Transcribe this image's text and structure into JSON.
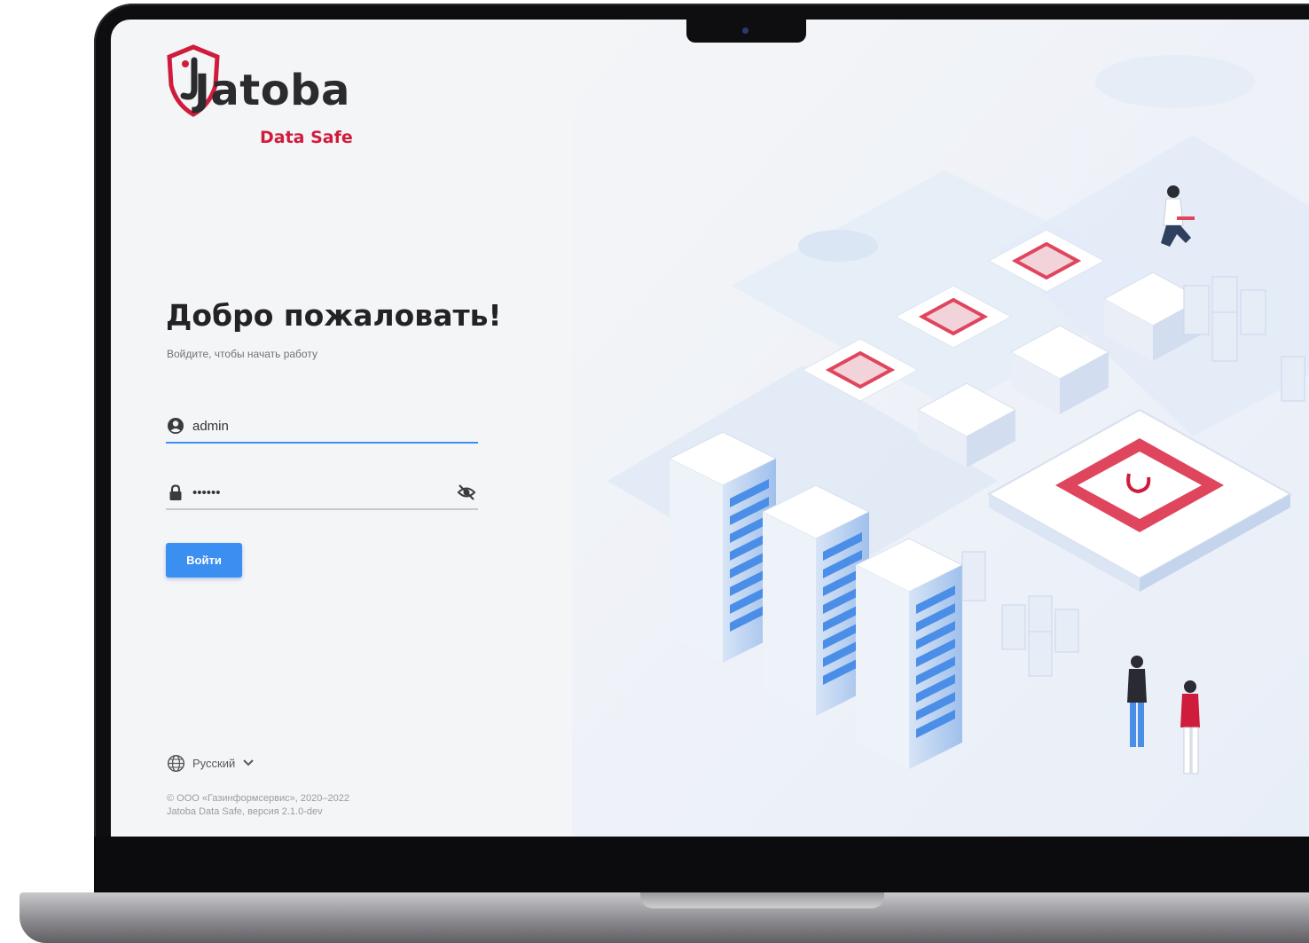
{
  "brand": {
    "name": "Jatoba",
    "tagline": "Data Safe",
    "accent_color": "#d01c3c"
  },
  "login": {
    "title": "Добро пожаловать!",
    "subtitle": "Войдите, чтобы начать работу",
    "username_value": "admin",
    "password_value": "••••••",
    "submit_label": "Войти",
    "primary_color": "#3b8ff0"
  },
  "footer": {
    "language": "Русский",
    "copyright_line1": "© ООО «Газинформсервис», 2020–2022",
    "copyright_line2": "Jatoba Data Safe, версия 2.1.0-dev"
  },
  "icons": {
    "username": "user-circle-icon",
    "password": "lock-icon",
    "visibility": "eye-off-icon",
    "language": "globe-icon",
    "dropdown": "chevron-down-icon"
  }
}
